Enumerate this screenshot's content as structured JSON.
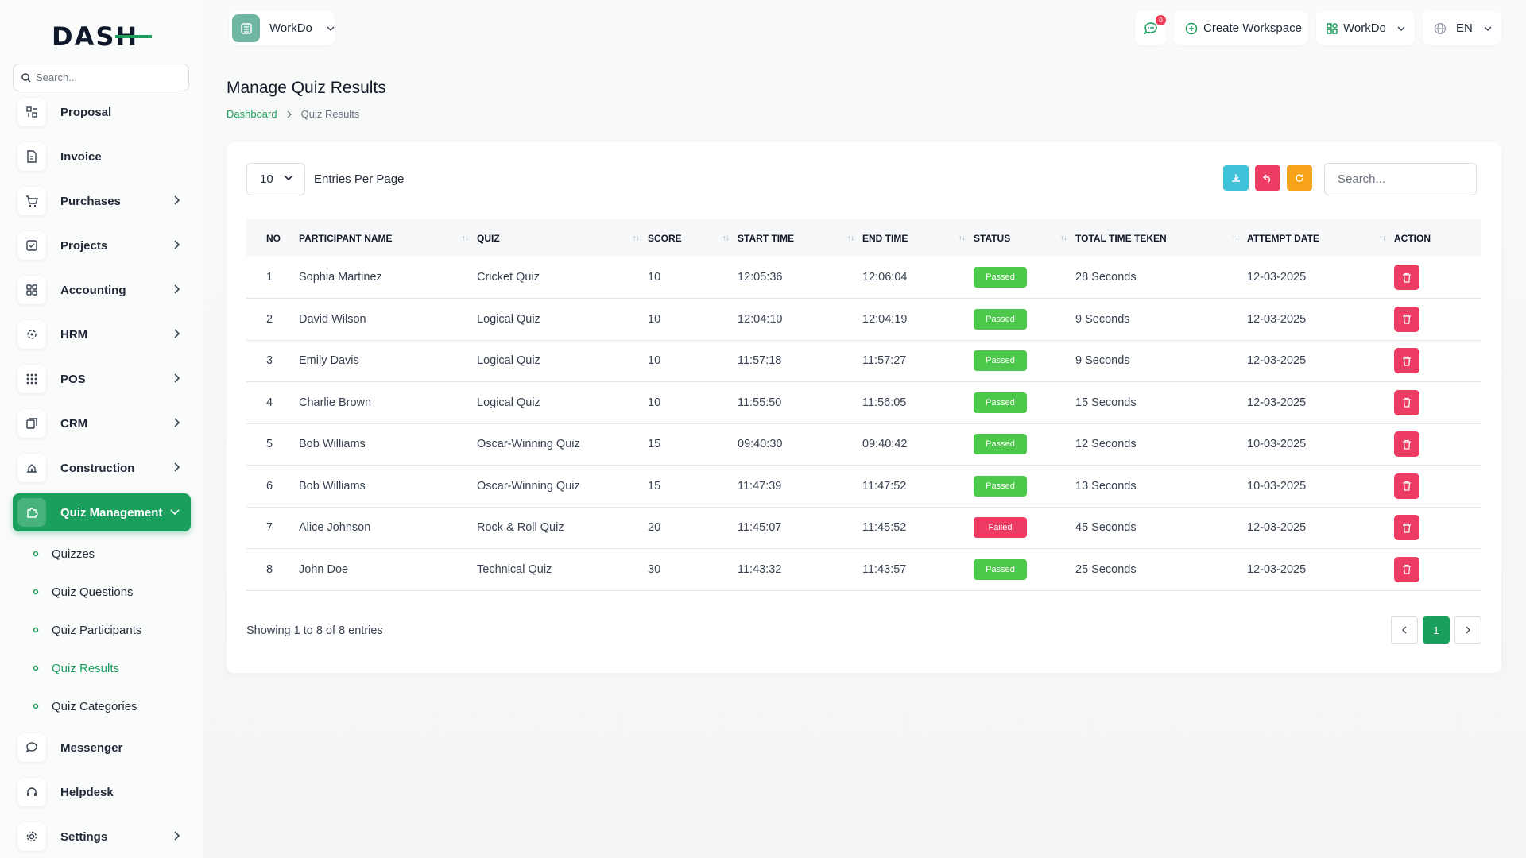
{
  "brand": {
    "logo_text": "DASH"
  },
  "sidebar": {
    "search_placeholder": "Search...",
    "items": [
      {
        "label": "Proposal",
        "has_chevron": false
      },
      {
        "label": "Invoice",
        "has_chevron": false
      },
      {
        "label": "Purchases",
        "has_chevron": true
      },
      {
        "label": "Projects",
        "has_chevron": true
      },
      {
        "label": "Accounting",
        "has_chevron": true
      },
      {
        "label": "HRM",
        "has_chevron": true
      },
      {
        "label": "POS",
        "has_chevron": true
      },
      {
        "label": "CRM",
        "has_chevron": true
      },
      {
        "label": "Construction",
        "has_chevron": true
      },
      {
        "label": "Quiz Management",
        "has_chevron": true,
        "active": true
      }
    ],
    "sub_items": [
      {
        "label": "Quizzes"
      },
      {
        "label": "Quiz Questions"
      },
      {
        "label": "Quiz Participants"
      },
      {
        "label": "Quiz Results",
        "active": true
      },
      {
        "label": "Quiz Categories"
      }
    ],
    "bottom_items": [
      {
        "label": "Messenger",
        "has_chevron": false
      },
      {
        "label": "Helpdesk",
        "has_chevron": false
      },
      {
        "label": "Settings",
        "has_chevron": true
      }
    ]
  },
  "topbar": {
    "workspace_name": "WorkDo",
    "notification_count": "0",
    "create_workspace": "Create Workspace",
    "workspace_menu": "WorkDo",
    "language": "EN"
  },
  "page": {
    "title": "Manage Quiz Results",
    "breadcrumb": {
      "home": "Dashboard",
      "current": "Quiz Results"
    }
  },
  "table_controls": {
    "per_page": "10",
    "per_page_label": "Entries Per Page",
    "search_placeholder": "Search..."
  },
  "columns": [
    "No",
    "Participant Name",
    "Quiz",
    "Score",
    "Start Time",
    "End Time",
    "Status",
    "Total Time Teken",
    "Attempt Date",
    "Action"
  ],
  "rows": [
    {
      "no": "1",
      "name": "Sophia Martinez",
      "quiz": "Cricket Quiz",
      "score": "10",
      "start": "12:05:36",
      "end": "12:06:04",
      "status": "Passed",
      "total": "28 Seconds",
      "date": "12-03-2025"
    },
    {
      "no": "2",
      "name": "David Wilson",
      "quiz": "Logical Quiz",
      "score": "10",
      "start": "12:04:10",
      "end": "12:04:19",
      "status": "Passed",
      "total": "9 Seconds",
      "date": "12-03-2025"
    },
    {
      "no": "3",
      "name": "Emily Davis",
      "quiz": "Logical Quiz",
      "score": "10",
      "start": "11:57:18",
      "end": "11:57:27",
      "status": "Passed",
      "total": "9 Seconds",
      "date": "12-03-2025"
    },
    {
      "no": "4",
      "name": "Charlie Brown",
      "quiz": "Logical Quiz",
      "score": "10",
      "start": "11:55:50",
      "end": "11:56:05",
      "status": "Passed",
      "total": "15 Seconds",
      "date": "12-03-2025"
    },
    {
      "no": "5",
      "name": "Bob Williams",
      "quiz": "Oscar-Winning Quiz",
      "score": "15",
      "start": "09:40:30",
      "end": "09:40:42",
      "status": "Passed",
      "total": "12 Seconds",
      "date": "10-03-2025"
    },
    {
      "no": "6",
      "name": "Bob Williams",
      "quiz": "Oscar-Winning Quiz",
      "score": "15",
      "start": "11:47:39",
      "end": "11:47:52",
      "status": "Passed",
      "total": "13 Seconds",
      "date": "10-03-2025"
    },
    {
      "no": "7",
      "name": "Alice Johnson",
      "quiz": "Rock & Roll Quiz",
      "score": "20",
      "start": "11:45:07",
      "end": "11:45:52",
      "status": "Failed",
      "total": "45 Seconds",
      "date": "12-03-2025"
    },
    {
      "no": "8",
      "name": "John Doe",
      "quiz": "Technical Quiz",
      "score": "30",
      "start": "11:43:32",
      "end": "11:43:57",
      "status": "Passed",
      "total": "25 Seconds",
      "date": "12-03-2025"
    }
  ],
  "footer": {
    "showing": "Showing 1 to 8 of 8 entries",
    "current_page": "1"
  },
  "colors": {
    "primary": "#1b9f5d",
    "passed": "#4cc84a",
    "failed": "#ed3c63",
    "download": "#3ec3d9",
    "reset": "#ed3c63",
    "refresh": "#f6a21b"
  }
}
